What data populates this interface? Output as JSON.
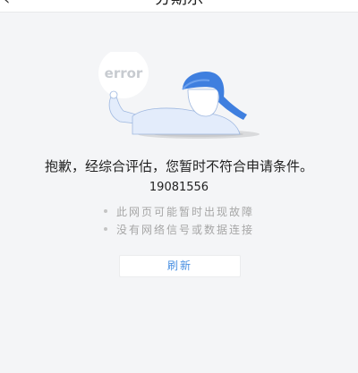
{
  "header": {
    "title": "分期乐",
    "back_icon": "back-arrow-icon"
  },
  "illustration": {
    "bubble_text": "error",
    "description_icon": "person-with-error-bubble-illustration"
  },
  "message": {
    "headline": "抱歉，经综合评估，您暂时不符合申请条件。",
    "code": "19081556"
  },
  "tips": [
    {
      "text": "此网页可能暂时出现故障"
    },
    {
      "text": "没有网络信号或数据连接"
    }
  ],
  "actions": {
    "refresh_label": "刷新"
  },
  "colors": {
    "background": "#f4f5f7",
    "accent": "#4a90e2",
    "tip_text": "#a6a6a6"
  }
}
